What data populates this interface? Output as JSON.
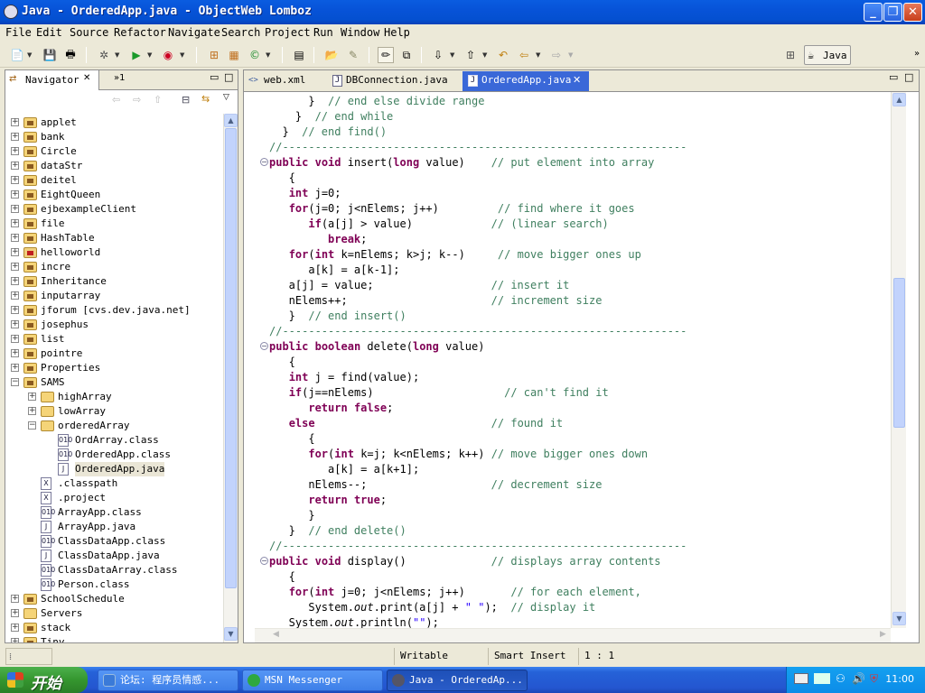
{
  "window": {
    "title": "Java - OrderedApp.java - ObjectWeb Lomboz",
    "min": "_",
    "max": "❐",
    "close": "✕"
  },
  "menu": [
    "File",
    "Edit",
    "Source",
    "Refactor",
    "Navigate",
    "Search",
    "Project",
    "Run",
    "Window",
    "Help"
  ],
  "perspective": {
    "label": "Java"
  },
  "navigator": {
    "tab_label": "Navigator",
    "tab_close": "✕",
    "overflow": "»1",
    "items": [
      {
        "label": "applet",
        "depth": 0,
        "exp": "+",
        "icon": "pkg"
      },
      {
        "label": "bank",
        "depth": 0,
        "exp": "+",
        "icon": "pkg"
      },
      {
        "label": "Circle",
        "depth": 0,
        "exp": "+",
        "icon": "pkg"
      },
      {
        "label": "dataStr",
        "depth": 0,
        "exp": "+",
        "icon": "pkg"
      },
      {
        "label": "deitel",
        "depth": 0,
        "exp": "+",
        "icon": "pkg"
      },
      {
        "label": "EightQueen",
        "depth": 0,
        "exp": "+",
        "icon": "pkg"
      },
      {
        "label": "ejbexampleClient",
        "depth": 0,
        "exp": "+",
        "icon": "pkg"
      },
      {
        "label": "file",
        "depth": 0,
        "exp": "+",
        "icon": "pkg"
      },
      {
        "label": "HashTable",
        "depth": 0,
        "exp": "+",
        "icon": "pkg"
      },
      {
        "label": "helloworld",
        "depth": 0,
        "exp": "+",
        "icon": "err"
      },
      {
        "label": "incre",
        "depth": 0,
        "exp": "+",
        "icon": "pkg"
      },
      {
        "label": "Inheritance",
        "depth": 0,
        "exp": "+",
        "icon": "pkg"
      },
      {
        "label": "inputarray",
        "depth": 0,
        "exp": "+",
        "icon": "pkg"
      },
      {
        "label": "jforum   [cvs.dev.java.net]",
        "depth": 0,
        "exp": "+",
        "icon": "pkg"
      },
      {
        "label": "josephus",
        "depth": 0,
        "exp": "+",
        "icon": "pkg"
      },
      {
        "label": "list",
        "depth": 0,
        "exp": "+",
        "icon": "pkg"
      },
      {
        "label": "pointre",
        "depth": 0,
        "exp": "+",
        "icon": "pkg"
      },
      {
        "label": "Properties",
        "depth": 0,
        "exp": "+",
        "icon": "pkg"
      },
      {
        "label": "SAMS",
        "depth": 0,
        "exp": "−",
        "icon": "pkg"
      },
      {
        "label": "highArray",
        "depth": 1,
        "exp": "+",
        "icon": "folder"
      },
      {
        "label": "lowArray",
        "depth": 1,
        "exp": "+",
        "icon": "folder"
      },
      {
        "label": "orderedArray",
        "depth": 1,
        "exp": "−",
        "icon": "folder"
      },
      {
        "label": "OrdArray.class",
        "depth": 2,
        "exp": "",
        "icon": "010"
      },
      {
        "label": "OrderedApp.class",
        "depth": 2,
        "exp": "",
        "icon": "010"
      },
      {
        "label": "OrderedApp.java",
        "depth": 2,
        "exp": "",
        "icon": "J",
        "selected": true
      },
      {
        "label": ".classpath",
        "depth": 1,
        "exp": "",
        "icon": "X"
      },
      {
        "label": ".project",
        "depth": 1,
        "exp": "",
        "icon": "X"
      },
      {
        "label": "ArrayApp.class",
        "depth": 1,
        "exp": "",
        "icon": "010"
      },
      {
        "label": "ArrayApp.java",
        "depth": 1,
        "exp": "",
        "icon": "J"
      },
      {
        "label": "ClassDataApp.class",
        "depth": 1,
        "exp": "",
        "icon": "010"
      },
      {
        "label": "ClassDataApp.java",
        "depth": 1,
        "exp": "",
        "icon": "J"
      },
      {
        "label": "ClassDataArray.class",
        "depth": 1,
        "exp": "",
        "icon": "010"
      },
      {
        "label": "Person.class",
        "depth": 1,
        "exp": "",
        "icon": "010"
      },
      {
        "label": "SchoolSchedule",
        "depth": 0,
        "exp": "+",
        "icon": "pkg"
      },
      {
        "label": "Servers",
        "depth": 0,
        "exp": "+",
        "icon": "plain"
      },
      {
        "label": "stack",
        "depth": 0,
        "exp": "+",
        "icon": "pkg"
      },
      {
        "label": "Tiny",
        "depth": 0,
        "exp": "+",
        "icon": "pkg"
      }
    ]
  },
  "editor": {
    "tabs": [
      {
        "label": "web.xml",
        "icon": "<>"
      },
      {
        "label": "DBConnection.java",
        "icon": "J"
      },
      {
        "label": "OrderedApp.java",
        "icon": "J",
        "active": true
      }
    ],
    "lines": [
      [
        [
          "      }  ",
          ""
        ],
        [
          "// end else divide range",
          "cm"
        ]
      ],
      [
        [
          "    }  ",
          ""
        ],
        [
          "// end while",
          "cm"
        ]
      ],
      [
        [
          "  }  ",
          ""
        ],
        [
          "// end find()",
          "cm"
        ]
      ],
      [
        [
          "//--------------------------------------------------------------",
          "cm"
        ]
      ],
      [
        [
          "public",
          "kw"
        ],
        [
          " ",
          ""
        ],
        [
          "void",
          "kw"
        ],
        [
          " insert(",
          ""
        ],
        [
          "long",
          "kw"
        ],
        [
          " value)    ",
          ""
        ],
        [
          "// put element into array",
          "cm"
        ]
      ],
      [
        [
          "   {",
          ""
        ]
      ],
      [
        [
          "   ",
          ""
        ],
        [
          "int",
          "kw"
        ],
        [
          " j=0;",
          ""
        ]
      ],
      [
        [
          "   ",
          ""
        ],
        [
          "for",
          "kw"
        ],
        [
          "(j=0; j<nElems; j++)         ",
          ""
        ],
        [
          "// find where it goes",
          "cm"
        ]
      ],
      [
        [
          "      ",
          ""
        ],
        [
          "if",
          "kw"
        ],
        [
          "(a[j] > value)            ",
          ""
        ],
        [
          "// (linear search)",
          "cm"
        ]
      ],
      [
        [
          "         ",
          ""
        ],
        [
          "break",
          "kw"
        ],
        [
          ";",
          ""
        ]
      ],
      [
        [
          "   ",
          ""
        ],
        [
          "for",
          "kw"
        ],
        [
          "(",
          ""
        ],
        [
          "int",
          "kw"
        ],
        [
          " k=nElems; k>j; k--)     ",
          ""
        ],
        [
          "// move bigger ones up",
          "cm"
        ]
      ],
      [
        [
          "      a[k] = a[k-1];",
          ""
        ]
      ],
      [
        [
          "   a[j] = value;                  ",
          ""
        ],
        [
          "// insert it",
          "cm"
        ]
      ],
      [
        [
          "   nElems++;                      ",
          ""
        ],
        [
          "// increment size",
          "cm"
        ]
      ],
      [
        [
          "   }  ",
          ""
        ],
        [
          "// end insert()",
          "cm"
        ]
      ],
      [
        [
          "//--------------------------------------------------------------",
          "cm"
        ]
      ],
      [
        [
          "public",
          "kw"
        ],
        [
          " ",
          ""
        ],
        [
          "boolean",
          "kw"
        ],
        [
          " delete(",
          ""
        ],
        [
          "long",
          "kw"
        ],
        [
          " value)",
          ""
        ]
      ],
      [
        [
          "   {",
          ""
        ]
      ],
      [
        [
          "   ",
          ""
        ],
        [
          "int",
          "kw"
        ],
        [
          " j = find(value);",
          ""
        ]
      ],
      [
        [
          "   ",
          ""
        ],
        [
          "if",
          "kw"
        ],
        [
          "(j==nElems)                    ",
          ""
        ],
        [
          "// can't find it",
          "cm"
        ]
      ],
      [
        [
          "      ",
          ""
        ],
        [
          "return",
          "kw"
        ],
        [
          " ",
          ""
        ],
        [
          "false",
          "kw"
        ],
        [
          ";",
          ""
        ]
      ],
      [
        [
          "   ",
          ""
        ],
        [
          "else",
          "kw"
        ],
        [
          "                           ",
          ""
        ],
        [
          "// found it",
          "cm"
        ]
      ],
      [
        [
          "      {",
          ""
        ]
      ],
      [
        [
          "      ",
          ""
        ],
        [
          "for",
          "kw"
        ],
        [
          "(",
          ""
        ],
        [
          "int",
          "kw"
        ],
        [
          " k=j; k<nElems; k++) ",
          ""
        ],
        [
          "// move bigger ones down",
          "cm"
        ]
      ],
      [
        [
          "         a[k] = a[k+1];",
          ""
        ]
      ],
      [
        [
          "      nElems--;                   ",
          ""
        ],
        [
          "// decrement size",
          "cm"
        ]
      ],
      [
        [
          "      ",
          ""
        ],
        [
          "return",
          "kw"
        ],
        [
          " ",
          ""
        ],
        [
          "true",
          "kw"
        ],
        [
          ";",
          ""
        ]
      ],
      [
        [
          "      }",
          ""
        ]
      ],
      [
        [
          "   }  ",
          ""
        ],
        [
          "// end delete()",
          "cm"
        ]
      ],
      [
        [
          "//--------------------------------------------------------------",
          "cm"
        ]
      ],
      [
        [
          "public",
          "kw"
        ],
        [
          " ",
          ""
        ],
        [
          "void",
          "kw"
        ],
        [
          " display()             ",
          ""
        ],
        [
          "// displays array contents",
          "cm"
        ]
      ],
      [
        [
          "   {",
          ""
        ]
      ],
      [
        [
          "   ",
          ""
        ],
        [
          "for",
          "kw"
        ],
        [
          "(",
          ""
        ],
        [
          "int",
          "kw"
        ],
        [
          " j=0; j<nElems; j++)       ",
          ""
        ],
        [
          "// for each element,",
          "cm"
        ]
      ],
      [
        [
          "      System.",
          ""
        ],
        [
          "out",
          "it"
        ],
        [
          ".print(a[j] + ",
          ""
        ],
        [
          "\" \"",
          "st"
        ],
        [
          ");  ",
          ""
        ],
        [
          "// display it",
          "cm"
        ]
      ],
      [
        [
          "   System.",
          ""
        ],
        [
          "out",
          "it"
        ],
        [
          ".println(",
          ""
        ],
        [
          "\"\"",
          "st"
        ],
        [
          ");",
          ""
        ]
      ]
    ],
    "fold_lines": [
      4,
      16,
      30
    ]
  },
  "status": {
    "writable": "Writable",
    "insert_mode": "Smart Insert",
    "position": "1 : 1"
  },
  "taskbar": {
    "start": "开始",
    "buttons": [
      {
        "label": "论坛: 程序员情感..."
      },
      {
        "label": "MSN Messenger"
      },
      {
        "label": "Java - OrderedAp...",
        "active": true
      }
    ],
    "clock": "11:00"
  }
}
